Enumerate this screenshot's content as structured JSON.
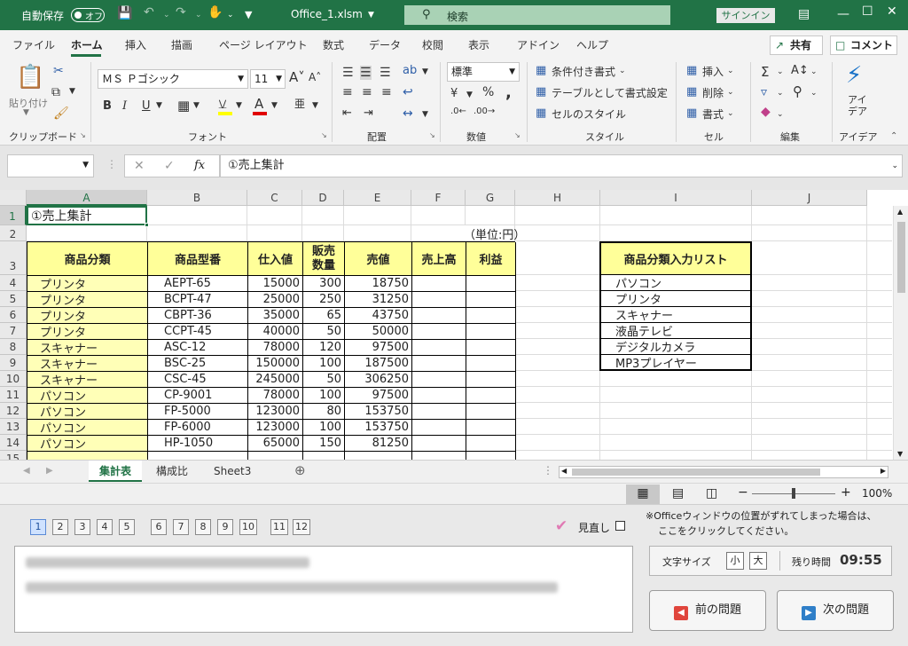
{
  "titlebar": {
    "autosave_label": "自動保存",
    "autosave_state": "オフ",
    "filename": "Office_1.xlsm",
    "search_placeholder": "検索",
    "signin_label": "サインイン"
  },
  "menubar": {
    "tabs": [
      "ファイル",
      "ホーム",
      "挿入",
      "描画",
      "ページ レイアウト",
      "数式",
      "データ",
      "校閲",
      "表示",
      "アドイン",
      "ヘルプ"
    ],
    "active_tab": "ホーム",
    "share_label": "共有",
    "comment_label": "コメント"
  },
  "ribbon": {
    "groups": {
      "clipboard": "クリップボード",
      "font": "フォント",
      "alignment": "配置",
      "number": "数値",
      "style": "スタイル",
      "cells": "セル",
      "editing": "編集",
      "ideas": "アイデア"
    },
    "paste_label": "貼り付け",
    "font_name": "ＭＳ Ｐゴシック",
    "font_size": "11",
    "number_format": "標準",
    "conditional_format": "条件付き書式",
    "format_as_table": "テーブルとして書式設定",
    "cell_styles": "セルのスタイル",
    "insert_label": "挿入",
    "delete_label": "削除",
    "format_label": "書式",
    "ideas_label": "アイデア",
    "bold": "B",
    "italic": "I",
    "underline": "U"
  },
  "formulabar": {
    "content": "①売上集計",
    "fx": "fx"
  },
  "sheet": {
    "columns": [
      "A",
      "B",
      "C",
      "D",
      "E",
      "F",
      "G",
      "H",
      "I",
      "J"
    ],
    "rows": [
      "1",
      "2",
      "3",
      "4",
      "5",
      "6",
      "7",
      "8",
      "9",
      "10",
      "11",
      "12",
      "13",
      "14",
      "15"
    ],
    "a1": "①売上集計",
    "unit_note": "（単位:円）",
    "headers": [
      "商品分類",
      "商品型番",
      "仕入値",
      "販売数量",
      "売値",
      "売上高",
      "利益"
    ],
    "header_qty_line1": "販売",
    "header_qty_line2": "数量",
    "data": [
      [
        "プリンタ",
        "AEPT-65",
        "15000",
        "300",
        "18750"
      ],
      [
        "プリンタ",
        "BCPT-47",
        "25000",
        "250",
        "31250"
      ],
      [
        "プリンタ",
        "CBPT-36",
        "35000",
        "65",
        "43750"
      ],
      [
        "プリンタ",
        "CCPT-45",
        "40000",
        "50",
        "50000"
      ],
      [
        "スキャナー",
        "ASC-12",
        "78000",
        "120",
        "97500"
      ],
      [
        "スキャナー",
        "BSC-25",
        "150000",
        "100",
        "187500"
      ],
      [
        "スキャナー",
        "CSC-45",
        "245000",
        "50",
        "306250"
      ],
      [
        "パソコン",
        "CP-9001",
        "78000",
        "100",
        "97500"
      ],
      [
        "パソコン",
        "FP-5000",
        "123000",
        "80",
        "153750"
      ],
      [
        "パソコン",
        "FP-6000",
        "123000",
        "100",
        "153750"
      ],
      [
        "パソコン",
        "HP-1050",
        "65000",
        "150",
        "81250"
      ]
    ],
    "list_header": "商品分類入力リスト",
    "list_items": [
      "パソコン",
      "プリンタ",
      "スキャナー",
      "液晶テレビ",
      "デジタルカメラ",
      "MP3プレイヤー"
    ]
  },
  "sheet_tabs": [
    "集計表",
    "構成比",
    "Sheet3"
  ],
  "statusbar": {
    "zoom": "100%"
  },
  "exam": {
    "questions": [
      "1",
      "2",
      "3",
      "4",
      "5",
      "6",
      "7",
      "8",
      "9",
      "10",
      "11",
      "12"
    ],
    "current": "1",
    "review_label": "見直し",
    "notice_line1": "※Officeウィンドウの位置がずれてしまった場合は、",
    "notice_line2": "ここをクリックしてください。",
    "font_size_label": "文字サイズ",
    "small_label": "小",
    "large_label": "大",
    "time_label": "残り時間",
    "time_value": "09:55",
    "prev_label": "前の問題",
    "next_label": "次の問題"
  },
  "colors": {
    "excel_green": "#217346",
    "header_yellow": "#ffff99",
    "category_yellow": "#ffffb7"
  }
}
